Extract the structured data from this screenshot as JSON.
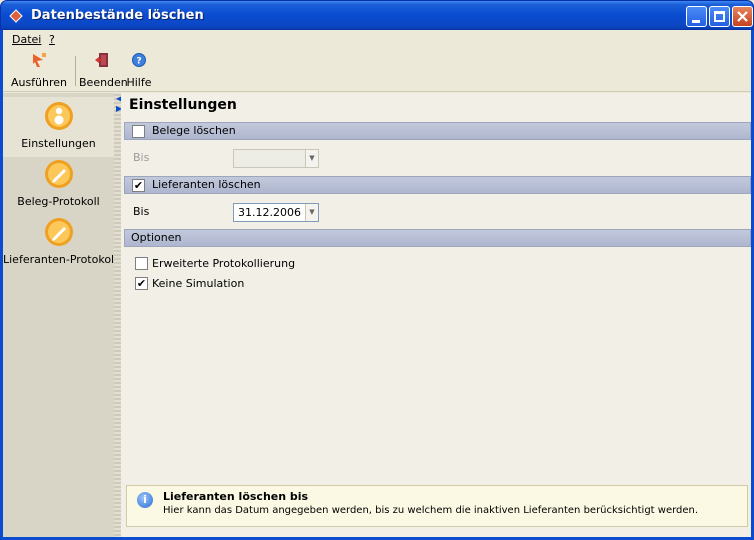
{
  "window": {
    "title": "Datenbestände löschen"
  },
  "menu": {
    "items": [
      "Datei",
      "?"
    ]
  },
  "toolbar": {
    "buttons": [
      {
        "label": "Ausführen",
        "icon": "run-icon"
      },
      {
        "label": "Beenden",
        "icon": "exit-icon"
      },
      {
        "label": "Hilfe",
        "icon": "help-icon"
      }
    ]
  },
  "nav": {
    "items": [
      {
        "label": "Einstellungen",
        "icon": "settings-icon",
        "active": true
      },
      {
        "label": "Beleg-Protokoll",
        "icon": "pencil-icon",
        "active": false
      },
      {
        "label": "Lieferanten-Protokoll",
        "icon": "pencil-icon",
        "active": false
      }
    ]
  },
  "content": {
    "title": "Einstellungen",
    "belege": {
      "label": "Belege löschen",
      "checked": false,
      "bis_label": "Bis",
      "bis_value": ""
    },
    "lieferanten": {
      "label": "Lieferanten löschen",
      "checked": true,
      "bis_label": "Bis",
      "bis_value": "31.12.2006"
    },
    "optionen": {
      "label": "Optionen",
      "options": [
        {
          "label": "Erweiterte Protokollierung",
          "checked": false
        },
        {
          "label": "Keine Simulation",
          "checked": true
        }
      ]
    },
    "info": {
      "title": "Lieferanten löschen bis",
      "text": "Hier kann das Datum angegeben werden, bis zu welchem die inaktiven Lieferanten berücksichtigt werden."
    }
  },
  "colors": {
    "titlebar": "#0A4CD0",
    "section_bar": "#AEB6CF",
    "info_bg": "#FBF9E3"
  }
}
